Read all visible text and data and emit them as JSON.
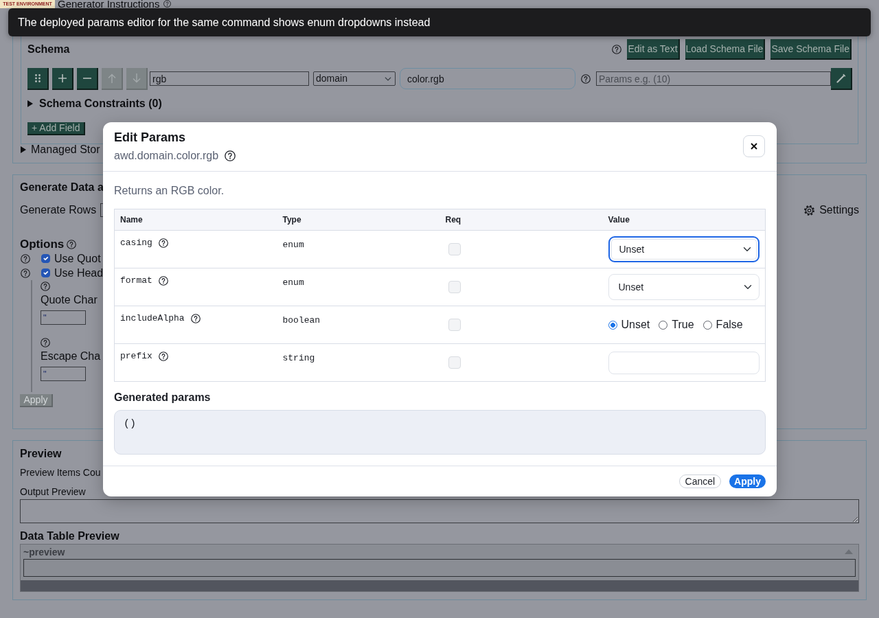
{
  "environment_badge": "TEST ENVIRONMENT",
  "page_title": "Generator Instructions",
  "toast": "The deployed params editor for the same command shows enum dropdowns instead",
  "schema": {
    "title": "Schema",
    "actions": [
      "Edit as Text",
      "Load Schema File",
      "Save Schema File"
    ],
    "field_row": {
      "tools": [
        {
          "kind": "drag",
          "disabled": false
        },
        {
          "kind": "add",
          "disabled": false
        },
        {
          "kind": "remove",
          "disabled": false
        },
        {
          "kind": "up",
          "disabled": true
        },
        {
          "kind": "down",
          "disabled": true
        }
      ],
      "name": "rgb",
      "generator": "domain",
      "command": "color.rgb",
      "params": {
        "placeholder": "Params e.g. (10)"
      }
    },
    "constraints": {
      "label": "Schema Constraints (0)",
      "expanded": false
    },
    "add_field": "+ Add Field"
  },
  "managed_store": {
    "label": "Managed Stor",
    "expanded": false
  },
  "generate": {
    "title": "Generate Data a",
    "rows_label": "Generate Rows",
    "settings": "Settings",
    "options_title": "Options",
    "checkboxes": [
      {
        "label": "Use Quot",
        "checked": true
      },
      {
        "label": "Use Head",
        "checked": true
      }
    ],
    "fields": [
      {
        "label": "Quote Char",
        "value": "\""
      },
      {
        "label": "Escape Cha",
        "value": "\""
      }
    ],
    "apply": {
      "label": "Apply",
      "disabled": true
    }
  },
  "preview": {
    "title": "Preview",
    "items_label": "Preview Items Cou",
    "output_label": "Output Preview",
    "table_title": "Data Table Preview",
    "table": {
      "columns": [
        "~preview"
      ]
    }
  },
  "modal": {
    "title": "Edit Params",
    "subtitle": "awd.domain.color.rgb",
    "description": "Returns an RGB color.",
    "columns": [
      "Name",
      "Type",
      "Req",
      "Value"
    ],
    "params": [
      {
        "name": "casing",
        "type": "enum",
        "required": false,
        "value": {
          "kind": "select",
          "value": "Unset",
          "focused": true
        }
      },
      {
        "name": "format",
        "type": "enum",
        "required": false,
        "value": {
          "kind": "select",
          "value": "Unset",
          "focused": false
        }
      },
      {
        "name": "includeAlpha",
        "type": "boolean",
        "required": false,
        "value": {
          "kind": "radio",
          "options": [
            {
              "label": "Unset",
              "selected": true
            },
            {
              "label": "True",
              "selected": false
            },
            {
              "label": "False",
              "selected": false
            }
          ]
        }
      },
      {
        "name": "prefix",
        "type": "string",
        "required": false,
        "value": {
          "kind": "text",
          "focused": false
        }
      }
    ],
    "generated_label": "Generated params",
    "generated": "()",
    "buttons": [
      {
        "label": "Cancel",
        "kind": "secondary"
      },
      {
        "label": "Apply",
        "kind": "primary"
      }
    ]
  }
}
